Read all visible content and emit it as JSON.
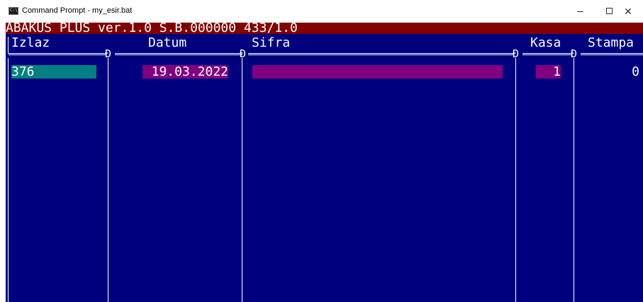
{
  "window": {
    "title": "Command Prompt - my_esir.bat",
    "icon_text": "C:\\",
    "minimize_glyph": "—",
    "maximize_glyph": "☐",
    "close_glyph": "✕"
  },
  "console": {
    "banner": "ABAKUS PLUS ver.1.0 S.B.000000 433/1.0",
    "columns": [
      "Izlaz",
      "Datum",
      "Sifra",
      "Kasa",
      "Stampa"
    ],
    "junction_glyph": "Ð",
    "rows": [
      {
        "izlaz": "376",
        "datum": "19.03.2022",
        "sifra": "",
        "kasa": "1",
        "stampa": "0"
      }
    ]
  },
  "colors": {
    "console_bg": "#00007f",
    "banner_bg": "#800000",
    "selected_cell": "#008080",
    "field_bg": "#800080",
    "text": "#ffffff"
  }
}
